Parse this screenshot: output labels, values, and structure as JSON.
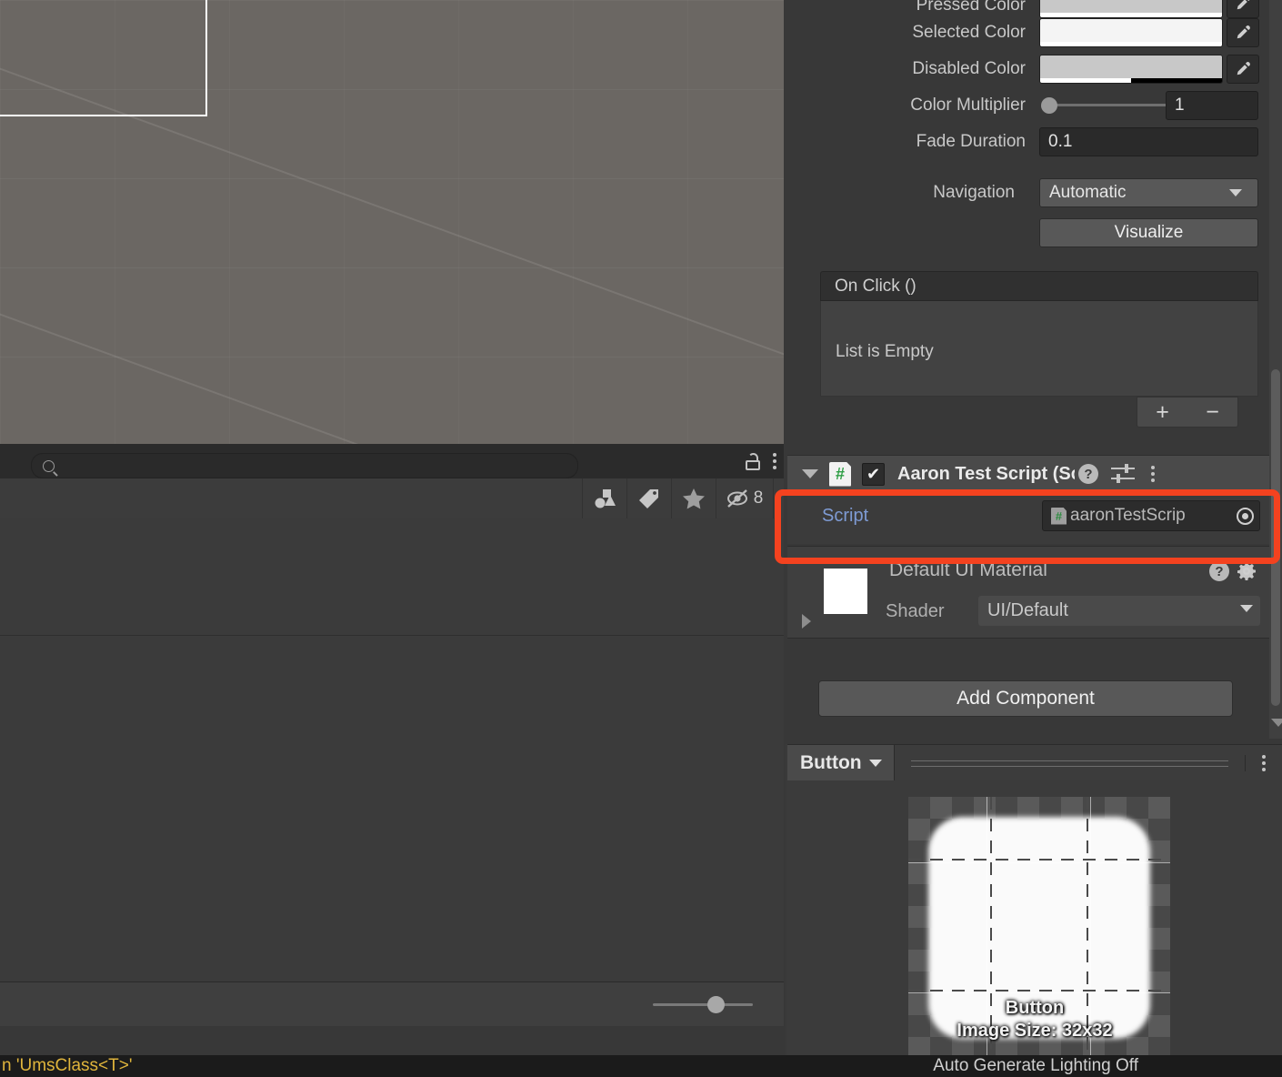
{
  "scene": {
    "name": "scene-view",
    "selection_outline": true
  },
  "inspector": {
    "button_component": {
      "colors": [
        {
          "label": "Pressed Color",
          "hex": "#c8c8c8",
          "alpha_pct": 100
        },
        {
          "label": "Selected Color",
          "hex": "#f4f4f4",
          "alpha_pct": 100
        },
        {
          "label": "Disabled Color",
          "hex": "#c8c8c8",
          "alpha_pct": 50
        }
      ],
      "color_multiplier": {
        "label": "Color Multiplier",
        "value": "1",
        "slider_pct": 0
      },
      "fade_duration": {
        "label": "Fade Duration",
        "value": "0.1"
      },
      "navigation": {
        "label": "Navigation",
        "value": "Automatic"
      },
      "visualize_button": "Visualize",
      "on_click": {
        "header": "On Click ()",
        "empty_text": "List is Empty",
        "add_label": "+",
        "remove_label": "−"
      }
    },
    "script_component": {
      "title": "Aaron Test Script (Scrip",
      "enabled": true,
      "script_field": {
        "label": "Script",
        "value": "aaronTestScrip"
      },
      "icons": {
        "foldout": "foldout-triangle-icon",
        "type": "csharp-script-icon",
        "checkbox": "enabled-checkbox",
        "help": "help-icon",
        "preset": "preset-icon",
        "menu": "kebab-menu-icon"
      }
    },
    "material": {
      "name": "Default UI Material",
      "shader_label": "Shader",
      "shader_value": "UI/Default"
    },
    "add_component": "Add Component"
  },
  "hierarchy": {
    "search": {
      "value": "",
      "placeholder": ""
    },
    "toolbar_icons": [
      "shapes-filter-icon",
      "tag-filter-icon",
      "favorite-star-icon",
      "hidden-objects-icon"
    ],
    "hidden_count": "8",
    "lock_icon": "lock-icon",
    "menu_icon": "kebab-menu-icon"
  },
  "preview": {
    "object_name": "Button",
    "overlay_name": "Button",
    "image_size_text": "Image Size: 32x32",
    "menu_icon": "kebab-menu-icon"
  },
  "status_bar": {
    "left_text": "n 'UmsClass<T>'",
    "right_text": "Auto Generate Lighting Off"
  },
  "annotation": {
    "color": "#f4421f",
    "target": "script-field-row"
  },
  "colors": {
    "panel_bg": "#383838",
    "header_bg": "#4a4a4a",
    "accent_blue": "#7e9bd4",
    "warning_yellow": "#e0b53c",
    "highlight_red": "#f4421f"
  }
}
